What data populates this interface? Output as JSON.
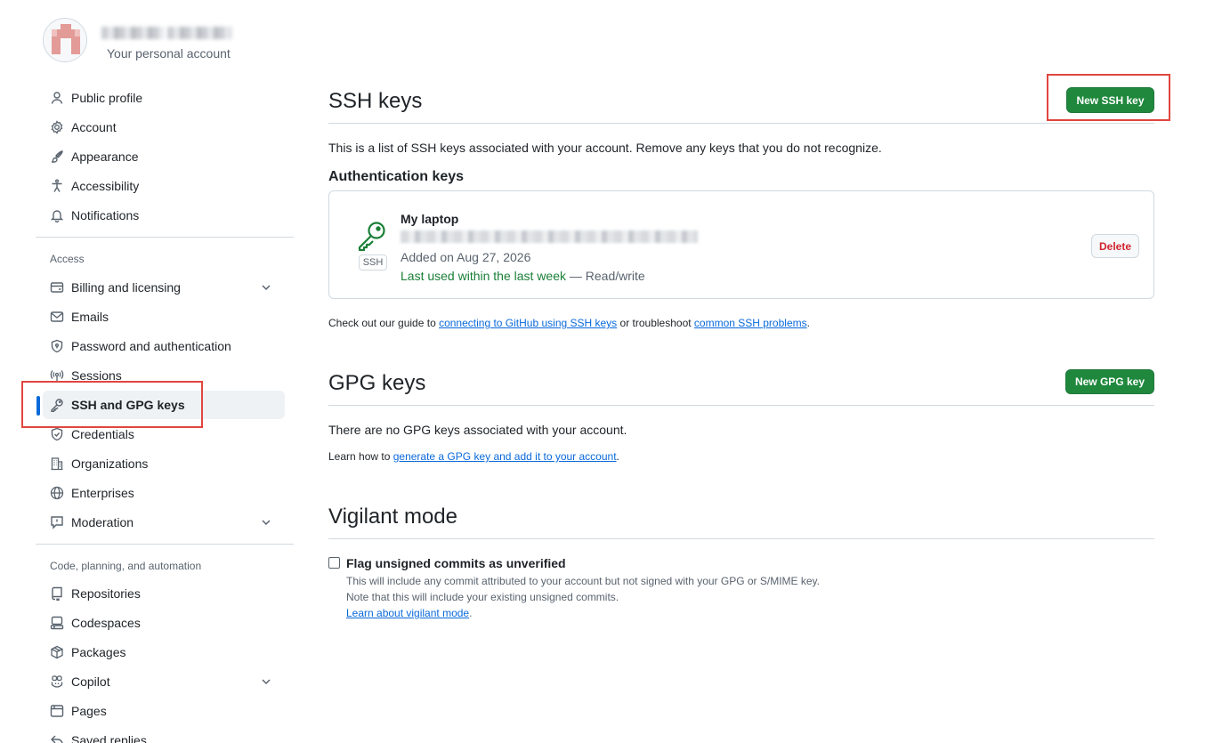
{
  "user": {
    "subtitle": "Your personal account"
  },
  "sidebar": {
    "items_top": [
      {
        "label": "Public profile",
        "icon": "person-icon"
      },
      {
        "label": "Account",
        "icon": "gear-icon"
      },
      {
        "label": "Appearance",
        "icon": "paintbrush-icon"
      },
      {
        "label": "Accessibility",
        "icon": "accessibility-icon"
      },
      {
        "label": "Notifications",
        "icon": "bell-icon"
      }
    ],
    "group_access": "Access",
    "items_access": [
      {
        "label": "Billing and licensing",
        "icon": "credit-card-icon"
      },
      {
        "label": "Emails",
        "icon": "mail-icon"
      },
      {
        "label": "Password and authentication",
        "icon": "shield-lock-icon"
      },
      {
        "label": "Sessions",
        "icon": "broadcast-icon"
      },
      {
        "label": "SSH and GPG keys",
        "icon": "key-icon"
      },
      {
        "label": "Credentials",
        "icon": "shield-check-icon"
      },
      {
        "label": "Organizations",
        "icon": "organization-icon"
      },
      {
        "label": "Enterprises",
        "icon": "globe-icon"
      },
      {
        "label": "Moderation",
        "icon": "report-icon"
      }
    ],
    "group_code": "Code, planning, and automation",
    "items_code": [
      {
        "label": "Repositories",
        "icon": "repo-icon"
      },
      {
        "label": "Codespaces",
        "icon": "codespaces-icon"
      },
      {
        "label": "Packages",
        "icon": "package-icon"
      },
      {
        "label": "Copilot",
        "icon": "copilot-icon"
      },
      {
        "label": "Pages",
        "icon": "browser-icon"
      },
      {
        "label": "Saved replies",
        "icon": "reply-icon"
      }
    ]
  },
  "ssh": {
    "title": "SSH keys",
    "new_button": "New SSH key",
    "description": "This is a list of SSH keys associated with your account. Remove any keys that you do not recognize.",
    "auth_heading": "Authentication keys",
    "key": {
      "title": "My laptop",
      "badge": "SSH",
      "added": "Added on Aug 27, 2026",
      "last_used": "Last used within the last week",
      "access": " — Read/write",
      "delete": "Delete"
    },
    "guide_prefix": "Check out our guide to ",
    "guide_link1": "connecting to GitHub using SSH keys",
    "guide_mid": " or troubleshoot ",
    "guide_link2": "common SSH problems",
    "guide_suffix": "."
  },
  "gpg": {
    "title": "GPG keys",
    "new_button": "New GPG key",
    "empty": "There are no GPG keys associated with your account.",
    "learn_prefix": "Learn how to ",
    "learn_link": "generate a GPG key and add it to your account",
    "learn_suffix": "."
  },
  "vigilant": {
    "title": "Vigilant mode",
    "checkbox_label": "Flag unsigned commits as unverified",
    "desc1": "This will include any commit attributed to your account but not signed with your GPG or S/MIME key.",
    "desc2": "Note that this will include your existing unsigned commits.",
    "link": "Learn about vigilant mode",
    "link_suffix": "."
  },
  "colors": {
    "accent": "#0969da",
    "primary_button": "#1f883d",
    "danger": "#d1242f",
    "highlight": "#e0463f"
  }
}
